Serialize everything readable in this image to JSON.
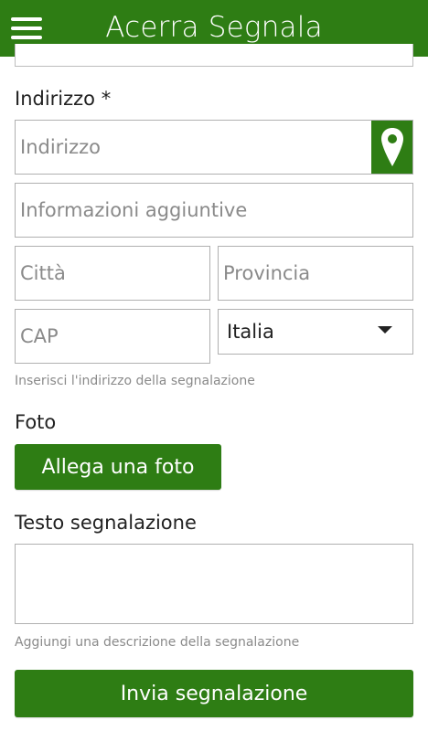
{
  "header": {
    "title": "Acerra Segnala"
  },
  "address": {
    "label": "Indirizzo *",
    "placeholder": "Indirizzo",
    "extra_placeholder": "Informazioni aggiuntive",
    "city_placeholder": "Città",
    "province_placeholder": "Provincia",
    "cap_placeholder": "CAP",
    "country_value": "Italia",
    "hint": "Inserisci l'indirizzo della segnalazione"
  },
  "photo": {
    "label": "Foto",
    "button": "Allega una foto"
  },
  "text": {
    "label": "Testo segnalazione",
    "hint": "Aggiungi una descrizione della segnalazione"
  },
  "submit": {
    "label": "Invia segnalazione"
  },
  "colors": {
    "accent": "#2e7d14"
  }
}
